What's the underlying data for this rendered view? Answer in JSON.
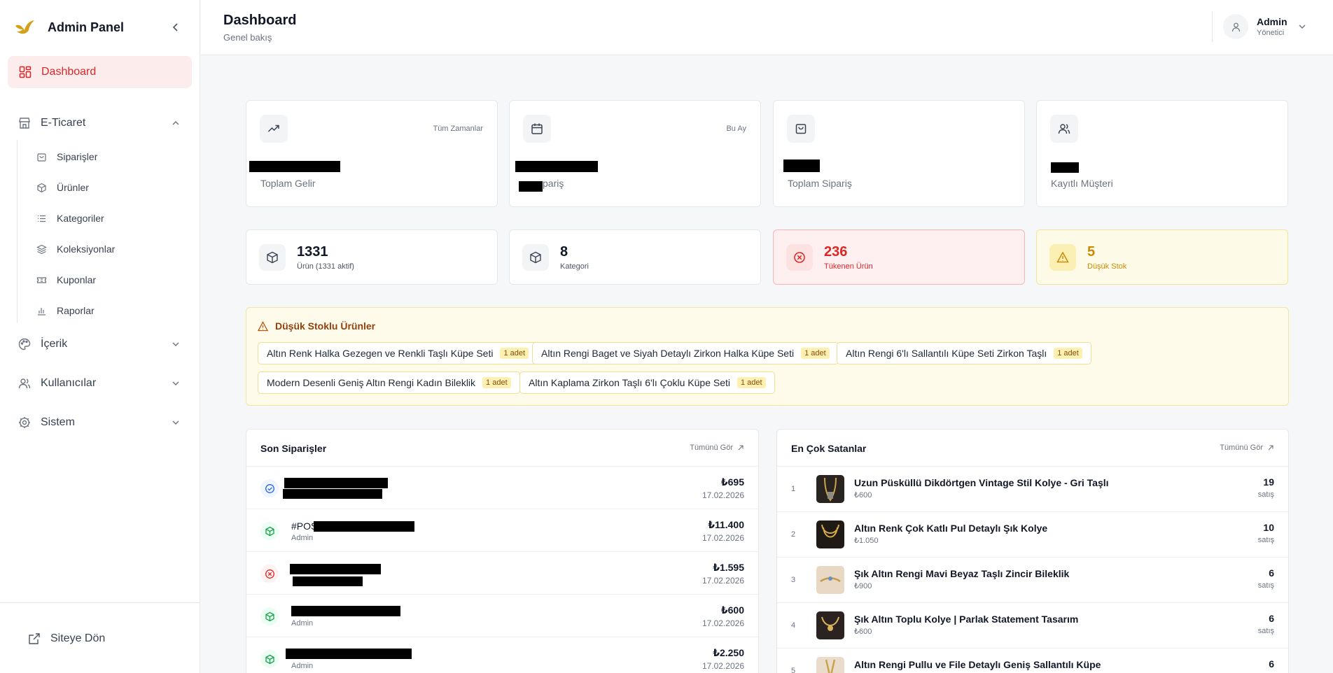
{
  "sidebar": {
    "brand": "Admin Panel",
    "active_item": "Dashboard",
    "groups": [
      {
        "label": "E-Ticaret",
        "icon": "store-icon",
        "expanded": true,
        "items": [
          "Siparişler",
          "Ürünler",
          "Kategoriler",
          "Koleksiyonlar",
          "Kuponlar",
          "Raporlar"
        ]
      },
      {
        "label": "İçerik",
        "icon": "palette-icon",
        "expanded": false
      },
      {
        "label": "Kullanıcılar",
        "icon": "users-icon",
        "expanded": false
      },
      {
        "label": "Sistem",
        "icon": "gear-icon",
        "expanded": false
      }
    ],
    "back_link": "Siteye Dön"
  },
  "header": {
    "title": "Dashboard",
    "subtitle": "Genel bakış",
    "user_name": "Admin",
    "user_role": "Yönetici"
  },
  "stats": [
    {
      "icon": "trending-up-icon",
      "period": "Tüm Zamanlar",
      "value": "[redacted]",
      "caption": "Toplam Gelir"
    },
    {
      "icon": "calendar-icon",
      "period": "Bu Ay",
      "value": "[redacted]",
      "caption": "pariş"
    },
    {
      "icon": "shopping-bag-icon",
      "period": "",
      "value": "[redacted]",
      "caption": "Toplam Sipariş"
    },
    {
      "icon": "users-icon",
      "period": "",
      "value": "[redacted]",
      "caption": "Kayıtlı Müşteri"
    }
  ],
  "mini_stats": [
    {
      "icon": "box-icon",
      "value": "1331",
      "caption": "Ürün (1331 aktif)",
      "tone": "neutral"
    },
    {
      "icon": "box-icon",
      "value": "8",
      "caption": "Kategori",
      "tone": "neutral"
    },
    {
      "icon": "x-circle-icon",
      "value": "236",
      "caption": "Tükenen Ürün",
      "tone": "danger"
    },
    {
      "icon": "warning-icon",
      "value": "5",
      "caption": "Düşük Stok",
      "tone": "warn"
    }
  ],
  "low_stock": {
    "title": "Düşük Stoklu Ürünler",
    "items": [
      {
        "name": "Altın Renk Halka Gezegen ve Renkli Taşlı Küpe Seti",
        "badge": "1 adet"
      },
      {
        "name": "Altın Rengi Baget ve Siyah Detaylı Zirkon Halka Küpe Seti",
        "badge": "1 adet"
      },
      {
        "name": "Altın Rengi 6'lı Sallantılı Küpe Seti Zirkon Taşlı",
        "badge": "1 adet"
      },
      {
        "name": "Modern Desenli Geniş Altın Rengi Kadın Bileklik",
        "badge": "1 adet"
      },
      {
        "name": "Altın Kaplama Zirkon Taşlı 6'lı Çoklu Küpe Seti",
        "badge": "1 adet"
      }
    ]
  },
  "recent_orders": {
    "title": "Son Siparişler",
    "link": "Tümünü Gör",
    "rows": [
      {
        "status": "check-circle-icon",
        "status_color": "#2563eb",
        "code": "",
        "by": "",
        "amount": "₺695",
        "date": "17.02.2026"
      },
      {
        "status": "package-icon",
        "status_color": "#16a34a",
        "code": "#POS",
        "by": "Admin",
        "amount": "₺11.400",
        "date": "17.02.2026"
      },
      {
        "status": "x-circle-icon",
        "status_color": "#dc2626",
        "code": "",
        "by": "",
        "amount": "₺1.595",
        "date": "17.02.2026"
      },
      {
        "status": "package-icon",
        "status_color": "#16a34a",
        "code": "",
        "by": "Admin",
        "amount": "₺600",
        "date": "17.02.2026"
      },
      {
        "status": "package-icon",
        "status_color": "#16a34a",
        "code": "",
        "by": "Admin",
        "amount": "₺2.250",
        "date": "17.02.2026"
      }
    ]
  },
  "best_sellers": {
    "title": "En Çok Satanlar",
    "link": "Tümünü Gör",
    "rows": [
      {
        "rank": "1",
        "name": "Uzun Püsküllü Dikdörtgen Vintage Stil Kolye - Gri Taşlı",
        "price": "₺600",
        "count": "19",
        "unit": "satış"
      },
      {
        "rank": "2",
        "name": "Altın Renk Çok Katlı Pul Detaylı Şık Kolye",
        "price": "₺1.050",
        "count": "10",
        "unit": "satış"
      },
      {
        "rank": "3",
        "name": "Şık Altın Rengi Mavi Beyaz Taşlı Zincir Bileklik",
        "price": "₺900",
        "count": "6",
        "unit": "satış"
      },
      {
        "rank": "4",
        "name": "Şık Altın Toplu Kolye | Parlak Statement Tasarım",
        "price": "₺600",
        "count": "6",
        "unit": "satış"
      },
      {
        "rank": "5",
        "name": "Altın Rengi Pullu ve File Detaylı Geniş Sallantılı Küpe",
        "price": "",
        "count": "6",
        "unit": ""
      }
    ]
  },
  "colors": {
    "accent": "#dc2626",
    "warn": "#ca8a04",
    "success": "#16a34a",
    "info": "#2563eb"
  }
}
